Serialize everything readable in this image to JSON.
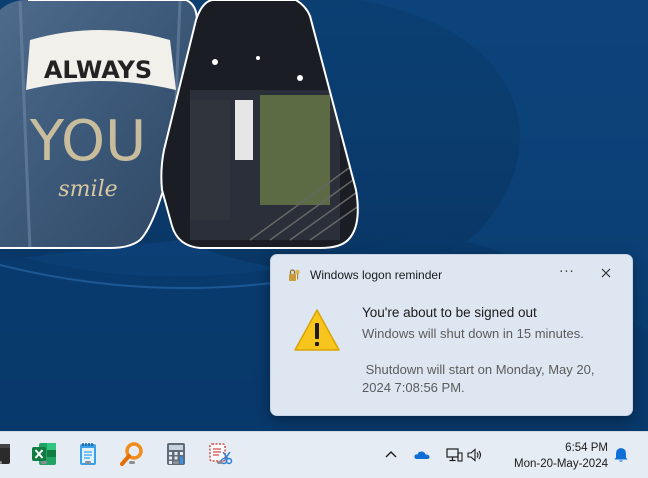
{
  "notification": {
    "app_icon": "key-padlock-icon",
    "app_name": "Windows logon reminder",
    "more_icon": "more-options-icon",
    "more_label": "···",
    "close_icon": "close-icon",
    "warning_icon": "warning-icon",
    "title": "You're about to be signed out",
    "body": "Windows will shut down in 15 minutes.",
    "detail": " Shutdown will start on Monday, May 20, 2024 7:08:56 PM."
  },
  "taskbar": {
    "apps": [
      {
        "name": "terminal",
        "icon": "terminal-icon"
      },
      {
        "name": "excel",
        "icon": "excel-icon"
      },
      {
        "name": "notepad",
        "icon": "notepad-icon"
      },
      {
        "name": "search-tool",
        "icon": "magnifier-icon"
      },
      {
        "name": "calculator",
        "icon": "calculator-icon"
      },
      {
        "name": "snipping-tool",
        "icon": "snip-icon"
      }
    ],
    "tray": {
      "chevron": "chevron-up-icon",
      "onedrive": "cloud-icon",
      "network": "network-icon",
      "volume": "speaker-icon",
      "notifications": "bell-icon"
    },
    "clock": {
      "time": "6:54 PM",
      "date": "Mon-20-May-2024"
    }
  },
  "colors": {
    "desktop_bg": "#0a3a6b",
    "toast_bg": "#dde6f1",
    "taskbar_bg": "#e6ecf4",
    "warning_yellow": "#f7c51d",
    "accent_blue": "#0067c0"
  }
}
